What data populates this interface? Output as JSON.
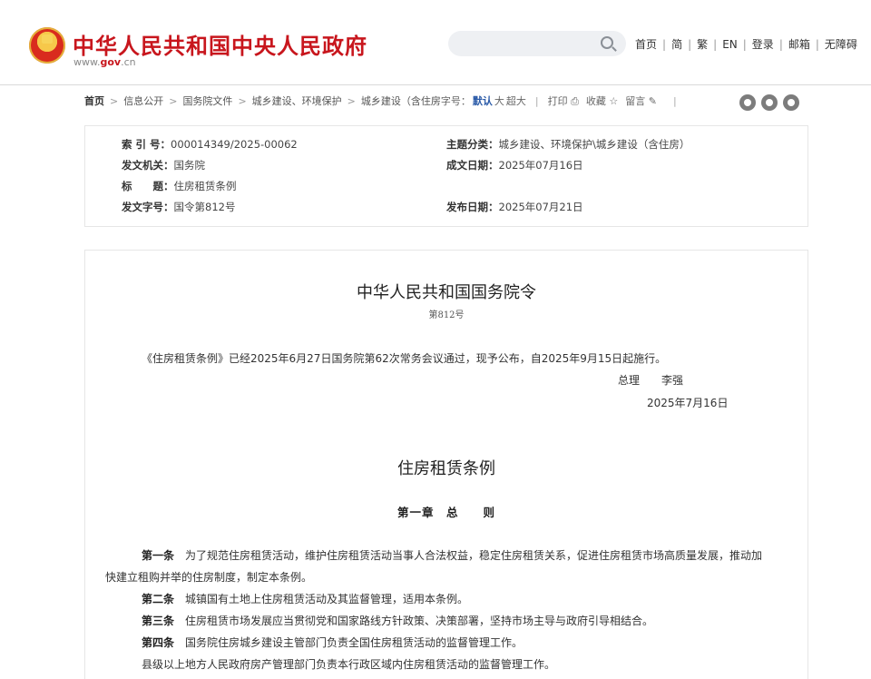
{
  "header": {
    "site_title": "中华人民共和国中央人民政府",
    "site_url_prefix": "www.",
    "site_url_domain": "gov",
    "site_url_suffix": ".cn",
    "search_placeholder": "",
    "nav": [
      "首页",
      "简",
      "繁",
      "EN",
      "登录",
      "邮箱",
      "无障碍"
    ]
  },
  "breadcrumb": {
    "items": [
      "首页",
      "信息公开",
      "国务院文件",
      "城乡建设、环境保护",
      "城乡建设（含住房"
    ],
    "font_label": "字号：",
    "size_default": "默认",
    "size_large": "大",
    "size_xlarge": "超大",
    "print": "打印",
    "collect": "收藏",
    "comment": "留言",
    "share_icons": [
      "weibo-icon",
      "wechat-icon",
      "qzone-icon"
    ]
  },
  "info": {
    "index_label": "索 引 号：",
    "index_value": "000014349/2025-00062",
    "topic_label": "主题分类：",
    "topic_value": "城乡建设、环境保护\\城乡建设（含住房）",
    "issuer_label": "发文机关：",
    "issuer_value": "国务院",
    "written_label": "成文日期：",
    "written_value": "2025年07月16日",
    "title_label": "标　　题：",
    "title_value": "住房租赁条例",
    "docno_label": "发文字号：",
    "docno_value": "国令第812号",
    "publish_label": "发布日期：",
    "publish_value": "2025年07月21日"
  },
  "document": {
    "order_title": "中华人民共和国国务院令",
    "order_no": "第812号",
    "announcement": "《住房租赁条例》已经2025年6月27日国务院第62次常务会议通过，现予公布，自2025年9月15日起施行。",
    "signer_title": "总理",
    "signer_name": "李强",
    "sign_date": "2025年7月16日",
    "law_title": "住房租赁条例",
    "chapter": "第一章　总　　则",
    "articles": [
      {
        "num": "第一条",
        "text": "为了规范住房租赁活动，维护住房租赁活动当事人合法权益，稳定住房租赁关系，促进住房租赁市场高质量发展，推动加"
      },
      {
        "num": "",
        "text": "快建立租购并举的住房制度，制定本条例。"
      },
      {
        "num": "第二条",
        "text": "城镇国有土地上住房租赁活动及其监督管理，适用本条例。"
      },
      {
        "num": "第三条",
        "text": "住房租赁市场发展应当贯彻党和国家路线方针政策、决策部署，坚持市场主导与政府引导相结合。"
      },
      {
        "num": "第四条",
        "text": "国务院住房城乡建设主管部门负责全国住房租赁活动的监督管理工作。"
      },
      {
        "num": "",
        "text": "县级以上地方人民政府房产管理部门负责本行政区域内住房租赁活动的监督管理工作。"
      }
    ]
  },
  "colors": {
    "brand_red": "#c8161d",
    "link_blue": "#2b5ba8"
  }
}
